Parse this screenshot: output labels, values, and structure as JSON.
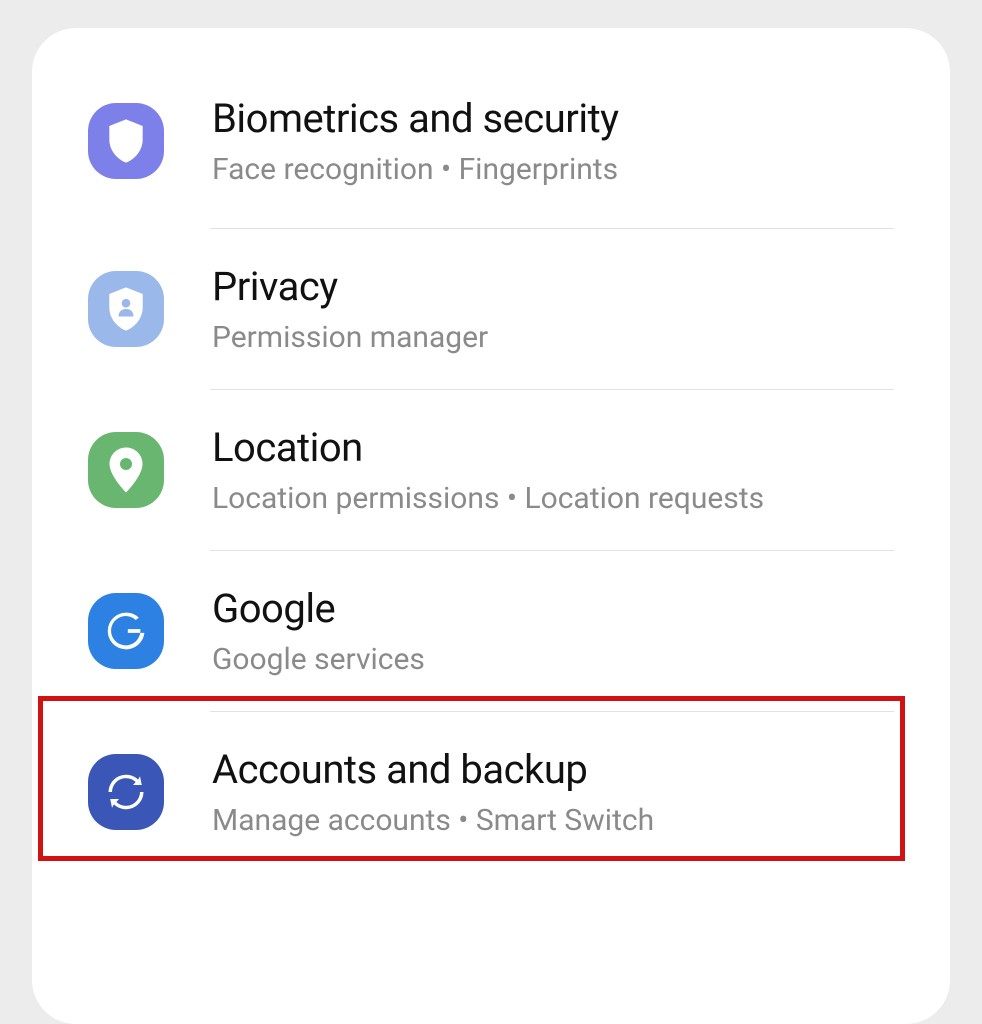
{
  "settings": {
    "items": [
      {
        "title": "Biometrics and security",
        "subtitle": "Face recognition  •  Fingerprints"
      },
      {
        "title": "Privacy",
        "subtitle": "Permission manager"
      },
      {
        "title": "Location",
        "subtitle": "Location permissions  •  Location requests"
      },
      {
        "title": "Google",
        "subtitle": "Google services"
      },
      {
        "title": "Accounts and backup",
        "subtitle": "Manage accounts  •  Smart Switch"
      }
    ]
  }
}
